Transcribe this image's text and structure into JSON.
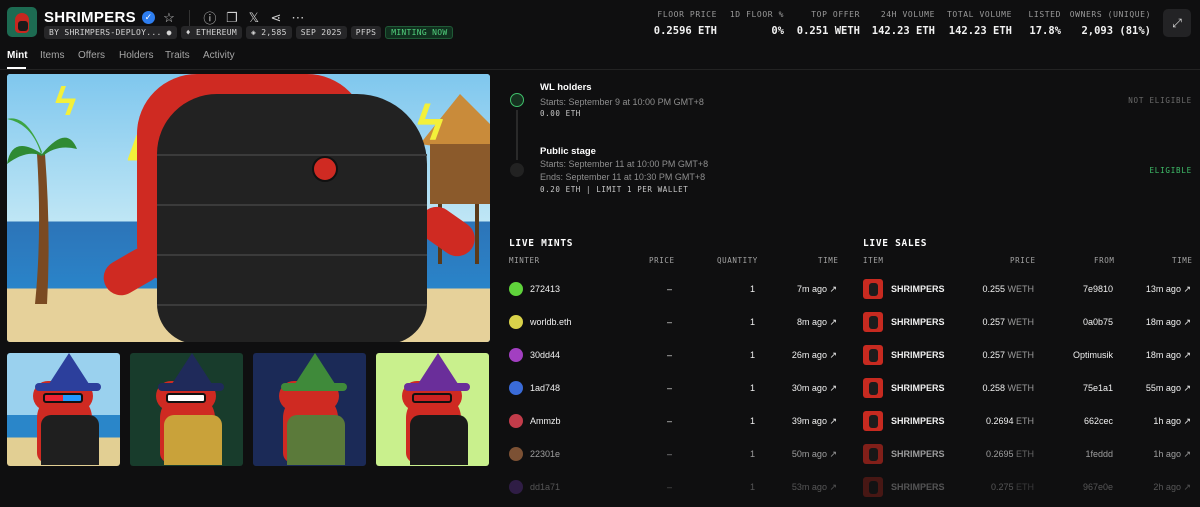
{
  "collection": {
    "name": "SHRIMPERS",
    "chips": [
      "BY SHRIMPERS-DEPLOY...",
      "ETHEREUM",
      "2,585",
      "SEP 2025",
      "PFPS",
      "MINTING NOW"
    ]
  },
  "stats": [
    {
      "label": "FLOOR PRICE",
      "value": "0.2596 ETH"
    },
    {
      "label": "1D FLOOR %",
      "value": "0%"
    },
    {
      "label": "TOP OFFER",
      "value": "0.251 WETH"
    },
    {
      "label": "24H VOLUME",
      "value": "142.23 ETH"
    },
    {
      "label": "TOTAL VOLUME",
      "value": "142.23 ETH"
    },
    {
      "label": "LISTED",
      "value": "17.8%"
    },
    {
      "label": "OWNERS (UNIQUE)",
      "value": "2,093 (81%)"
    }
  ],
  "tabs": [
    "Mint",
    "Items",
    "Offers",
    "Holders",
    "Traits",
    "Activity"
  ],
  "stages": [
    {
      "title": "WL holders",
      "line1": "Starts: September 9 at 10:00 PM GMT+8",
      "line2": "",
      "price": "0.00 ETH",
      "flag": "NOT ELIGIBLE",
      "flag_color": "#6b6b6b"
    },
    {
      "title": "Public stage",
      "line1": "Starts: September 11 at 10:00 PM GMT+8",
      "line2": "Ends: September 11 at 10:30 PM GMT+8",
      "price": "0.20 ETH | LIMIT 1 PER WALLET",
      "flag": "ELIGIBLE",
      "flag_color": "#3fbf6a"
    }
  ],
  "live_mints": {
    "title": "LIVE MINTS",
    "headers": [
      "MINTER",
      "PRICE",
      "QUANTITY",
      "TIME"
    ],
    "rows": [
      {
        "minter": "272413",
        "price": "–",
        "qty": "1",
        "time": "7m ago ↗",
        "avatar": "#5fd33b"
      },
      {
        "minter": "worldb.eth",
        "price": "–",
        "qty": "1",
        "time": "8m ago ↗",
        "avatar": "#d9d24a"
      },
      {
        "minter": "30dd44",
        "price": "–",
        "qty": "1",
        "time": "26m ago ↗",
        "avatar": "#a23fc1"
      },
      {
        "minter": "1ad748",
        "price": "–",
        "qty": "1",
        "time": "30m ago ↗",
        "avatar": "#3a6bd8"
      },
      {
        "minter": "Ammzb",
        "price": "–",
        "qty": "1",
        "time": "39m ago ↗",
        "avatar": "#c23c4a"
      },
      {
        "minter": "22301e",
        "price": "–",
        "qty": "1",
        "time": "50m ago ↗",
        "avatar": "#c07a4a"
      },
      {
        "minter": "dd1a71",
        "price": "–",
        "qty": "1",
        "time": "53m ago ↗",
        "avatar": "#7a3fc1"
      }
    ]
  },
  "live_sales": {
    "title": "LIVE SALES",
    "headers": [
      "ITEM",
      "PRICE",
      "FROM",
      "TIME"
    ],
    "rows": [
      {
        "item": "SHRIMPERS",
        "price": "0.255",
        "unit": "WETH",
        "from": "7e9810",
        "time": "13m ago ↗"
      },
      {
        "item": "SHRIMPERS",
        "price": "0.257",
        "unit": "WETH",
        "from": "0a0b75",
        "time": "18m ago ↗"
      },
      {
        "item": "SHRIMPERS",
        "price": "0.257",
        "unit": "WETH",
        "from": "Optimusik",
        "time": "18m ago ↗"
      },
      {
        "item": "SHRIMPERS",
        "price": "0.258",
        "unit": "WETH",
        "from": "75e1a1",
        "time": "55m ago ↗"
      },
      {
        "item": "SHRIMPERS",
        "price": "0.2694",
        "unit": "ETH",
        "from": "662cec",
        "time": "1h ago ↗"
      },
      {
        "item": "SHRIMPERS",
        "price": "0.2695",
        "unit": "ETH",
        "from": "1feddd",
        "time": "1h ago ↗"
      },
      {
        "item": "SHRIMPERS",
        "price": "0.275",
        "unit": "ETH",
        "from": "967e0e",
        "time": "2h ago ↗"
      }
    ]
  },
  "icons": {
    "verified": "verified-check-icon",
    "star": "star-icon",
    "info": "info-icon",
    "copy": "copy-icon",
    "x": "x-logo-icon",
    "share": "share-icon",
    "more": "more-icon",
    "expand": "expand-icon"
  },
  "colors": {
    "accent_green": "#3fbf6a",
    "brand_red": "#c7271f",
    "background": "#0f0f10"
  }
}
